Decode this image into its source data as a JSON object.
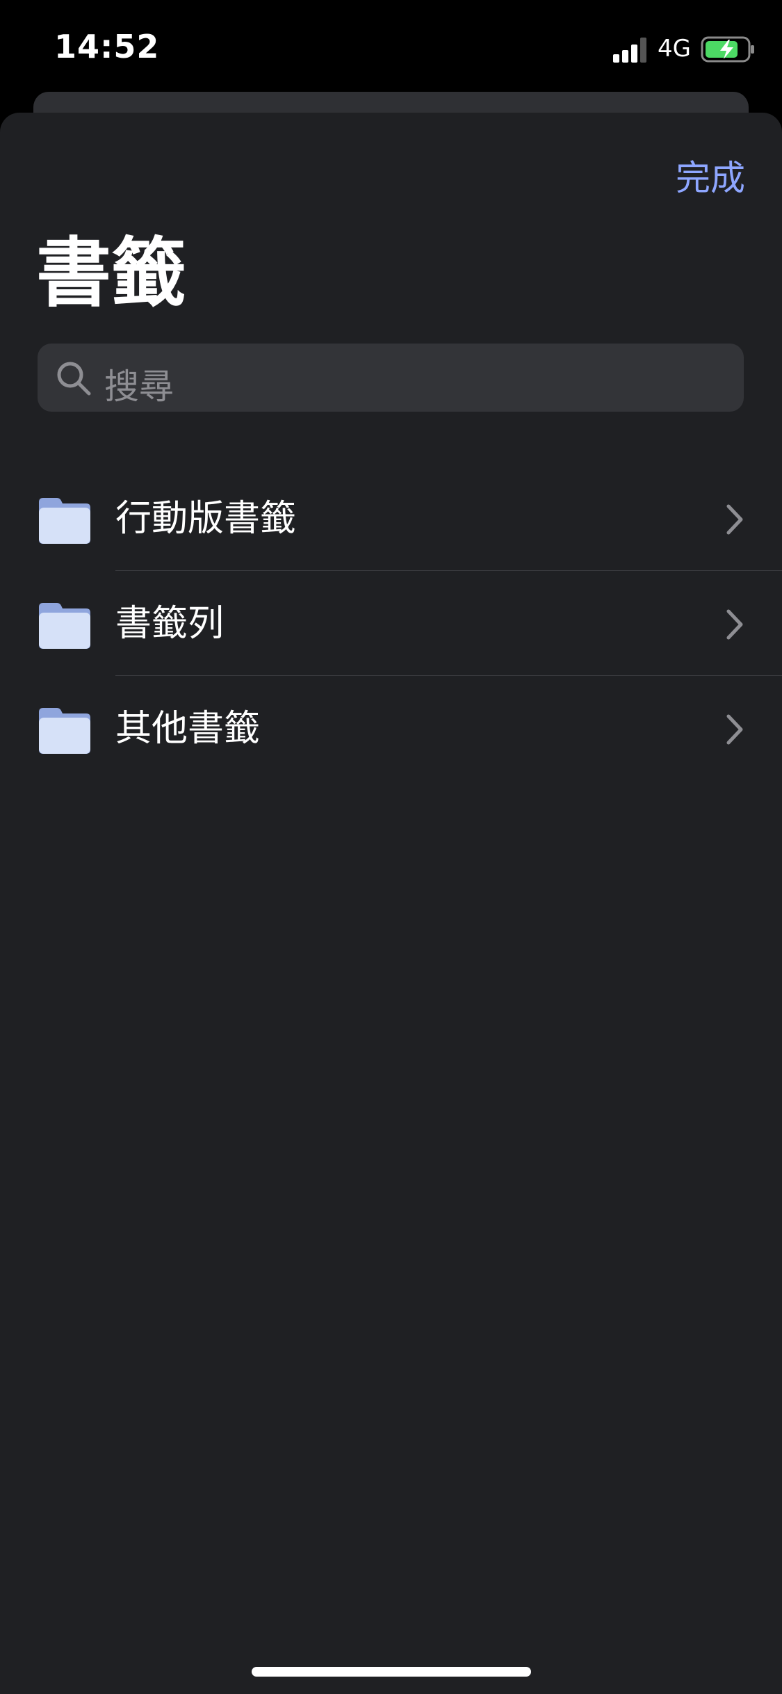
{
  "status_bar": {
    "time": "14:52",
    "network": "4G",
    "icons": [
      "signal-icon",
      "battery-charging-icon"
    ]
  },
  "header": {
    "done_label": "完成",
    "title": "書籤"
  },
  "search": {
    "placeholder": "搜尋",
    "icon": "search-icon"
  },
  "bookmarks": {
    "items": [
      {
        "label": "行動版書籤",
        "icon": "folder-icon"
      },
      {
        "label": "書籤列",
        "icon": "folder-icon"
      },
      {
        "label": "其他書籤",
        "icon": "folder-icon"
      }
    ]
  },
  "colors": {
    "accent": "#8ea6ff",
    "background": "#1f2023",
    "search_field": "#333438",
    "folder": "#c9d6f5"
  }
}
